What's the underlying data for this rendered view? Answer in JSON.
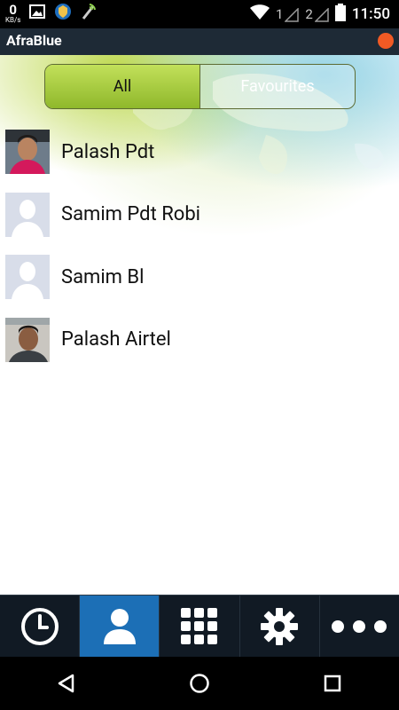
{
  "status_bar": {
    "data_rate_value": "0",
    "data_rate_unit": "KB/s",
    "sim1_label": "1",
    "sim2_label": "2",
    "time": "11:50"
  },
  "app": {
    "title": "AfraBlue",
    "accent_color": "#f15a24"
  },
  "segments": {
    "all": "All",
    "favourites": "Favourites",
    "selected": "All"
  },
  "contacts": [
    {
      "name": "Palash Pdt",
      "avatar": "photo"
    },
    {
      "name": "Samim Pdt Robi",
      "avatar": "placeholder"
    },
    {
      "name": "Samim Bl",
      "avatar": "placeholder"
    },
    {
      "name": "Palash Airtel",
      "avatar": "photo"
    }
  ],
  "bottom_nav": {
    "items": [
      {
        "icon": "clock-icon",
        "active": false
      },
      {
        "icon": "contact-person-icon",
        "active": true
      },
      {
        "icon": "dialpad-icon",
        "active": false
      },
      {
        "icon": "gear-icon",
        "active": false
      },
      {
        "icon": "more-dots-icon",
        "active": false
      }
    ],
    "active_color": "#1c6fb6"
  }
}
